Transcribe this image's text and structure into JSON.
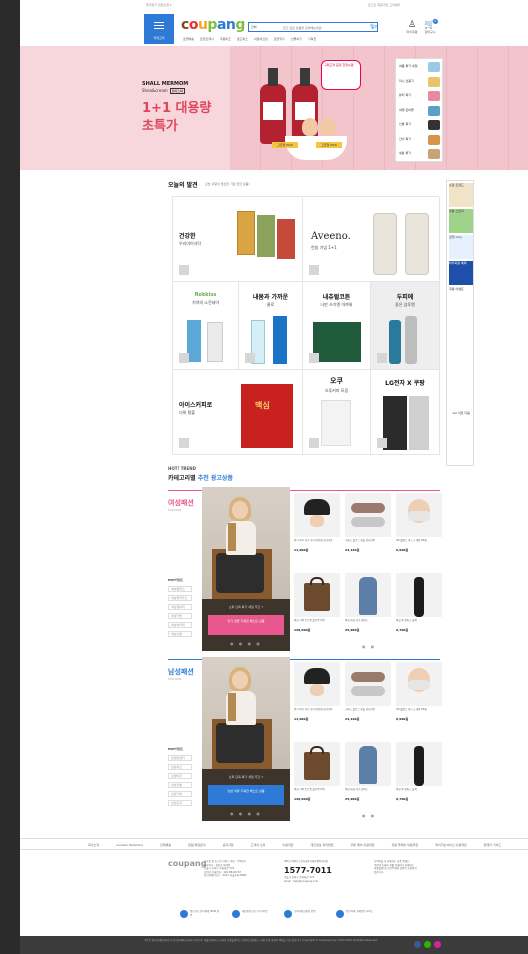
{
  "topbar": {
    "left": "즐겨찾기  입점신청 ▾",
    "right": "로그인  회원가입  고객센터"
  },
  "header": {
    "category_label": "카테고리",
    "logo_letters": [
      {
        "ch": "c",
        "color": "#7b4a1f"
      },
      {
        "ch": "o",
        "color": "#e8312e"
      },
      {
        "ch": "u",
        "color": "#f5a623"
      },
      {
        "ch": "p",
        "color": "#7fbf3f"
      },
      {
        "ch": "a",
        "color": "#2f7ad6"
      },
      {
        "ch": "n",
        "color": "#2f7ad6"
      },
      {
        "ch": "g",
        "color": "#7fbf3f"
      }
    ],
    "search_category": "전체",
    "search_placeholder": "찾고 싶은 상품을 검색해보세요!",
    "quicklinks": [
      "로켓배송",
      "로켓프레시",
      "쿠팡비즈",
      "골드박스",
      "이달의신상",
      "로켓직구",
      "선물하기",
      "기획전"
    ],
    "mypage": "마이쿠팡",
    "cart": "장바구니",
    "cart_count": "0"
  },
  "hero": {
    "brand1": "SHALL MERMOM",
    "brand2": "Shea&cream",
    "brand2_tag": "모이스처",
    "headline_line1": "1+1 대용량",
    "headline_line2": "초특가",
    "sticker": "구매고객 증정 한정수량",
    "tag": "고급형 PICK",
    "side_items": [
      "여름 특가 세일",
      "미니 선풍기",
      "뷰티 특가",
      "여행 준비물",
      "신발 특가",
      "간식 특가",
      "생활 특가"
    ]
  },
  "today": {
    "title": "오늘의 발견",
    "subtitle": "오늘 쿠팡이 엄선한 가장 핫한 상품!",
    "cells": [
      {
        "t1": "건강한",
        "t2": "우리아이식탁"
      },
      {
        "t1": "Aveeno.",
        "t2": "런칭 기념 1+1"
      },
      {
        "t1": "Rokkiss",
        "t2": "치약의 소전세어"
      },
      {
        "t1": "내몸과 가까운",
        "t2": "물로"
      },
      {
        "t1": "내츄럴코튼",
        "t2": "나만 쓰기엔 아까워"
      },
      {
        "t1": "두피에",
        "t2": "좋은 샴푸엔"
      },
      {
        "t1": "아이스커피로",
        "t2": "더위 탈출"
      },
      {
        "t1": "오쿠",
        "t2": "오투커피 모음"
      },
      {
        "t1": "LG전자 X 쿠팡",
        "t2": ""
      }
    ],
    "maxim_label": "맥심"
  },
  "sidebar_right": [
    "쇼핑 트렌드",
    "쿠팡 스토리",
    "로켓 only",
    "와우회원 혜택",
    "쿠팡 이벤트",
    "1/2 이전 다음"
  ],
  "hot": {
    "label": "HOT! TREND",
    "title_prefix": "카테고리별",
    "title_emph": "추천 광고상품"
  },
  "sections": [
    {
      "name": "여성패션",
      "name_en": "FASHION",
      "accent": "#e8588e",
      "hot_keyword_label": "HOT키워드",
      "keywords": [
        "여성원피스",
        "여성블라우스",
        "여성청바지",
        "여성가방",
        "여성슬리퍼",
        "여성신발"
      ],
      "model_caption": "쇼퍼 단독 특가 세일 주간 7",
      "cta": "인기 샌들 기획전 베스트 상품",
      "products": [
        {
          "name": "인기 특가 셔츠 모자 버킷햇 남녀공용",
          "price": "11,900원"
        },
        {
          "name": "크록스 클로그 샌들 남녀공용",
          "price": "24,120원"
        },
        {
          "name": "3D 웰킵스 마스크 대형 50매",
          "price": "6,990원"
        },
        {
          "name": "여성 가죽 토트백 숄더백 빅백",
          "price": "129,000원"
        },
        {
          "name": "여성 데님 셔츠 원피스",
          "price": "25,900원"
        },
        {
          "name": "여성 롱 원피스 블랙",
          "price": "9,700원"
        }
      ]
    },
    {
      "name": "남성패션",
      "name_en": "FASHION",
      "accent": "#2f7ad6",
      "hot_keyword_label": "HOT키워드",
      "keywords": [
        "남성반팔티",
        "남성셔츠",
        "남성바지",
        "남성신발",
        "남성가방",
        "남성모자"
      ],
      "model_caption": "쇼퍼 단독 특가 세일 주간 7",
      "cta": "남성 의류 기획전 베스트 상품",
      "products": [
        {
          "name": "인기 특가 셔츠 모자 버킷햇 남녀공용",
          "price": "11,900원"
        },
        {
          "name": "크록스 클로그 샌들 남녀공용",
          "price": "24,120원"
        },
        {
          "name": "3D 웰킵스 마스크 대형 50매",
          "price": "6,990원"
        },
        {
          "name": "여성 가죽 토트백 숄더백 빅백",
          "price": "129,000원"
        },
        {
          "name": "여성 데님 셔츠 원피스",
          "price": "25,900원"
        },
        {
          "name": "여성 롱 원피스 블랙",
          "price": "9,700원"
        }
      ]
    }
  ],
  "footer": {
    "links": [
      "회사소개",
      "Investor Relations",
      "인재채용",
      "입점/제휴문의",
      "공지사항",
      "고객의 소리",
      "이용약관",
      "개인정보 처리방침",
      "쿠팡 페이 이용약관",
      "쿠팡 플레이 이용약관",
      "위치기반서비스 이용약관",
      "판매자 가이드"
    ],
    "logo": "coupang",
    "company": "상호명 및 호스팅 서비스 제공 : 쿠팡(주)\n대표이사 : 강한승,박대준\n서울시 송파구 송파대로 570\n사업자 등록번호 : 120-88-00767\n통신판매업신고 : 2017-서울송파-0680",
    "cs_label": "365고객센터 | 전자금융거래분쟁처리담당",
    "phone": "1577-7011",
    "cs_detail": "서울시 송파구 송파대로 570\nemail : help@coupang.com",
    "notice": "사이버몰 내 판매되는 상품 중에는\n쿠팡에 등록한 개별 판매자가 판매하는\n마켓플레이스(오픈마켓) 상품이 포함되어\n있습니다.",
    "certs": [
      "정보보호 관리체계 ISMS 인증",
      "개인정보보호 우수사이트",
      "소비자중심경영 인증",
      "안전거래 구매안전 서비스"
    ],
    "bottom_text": "쿠팡은 통신판매중개자로서 통신판매의 당사자가 아니며, 개별 판매자가 등록한 마켓플레이스 상품의 상품정보, 거래 등에 대하여 책임을 지지 않습니다. Copyright © Coupang Corp. 2010-2024 All Rights Reserved."
  }
}
